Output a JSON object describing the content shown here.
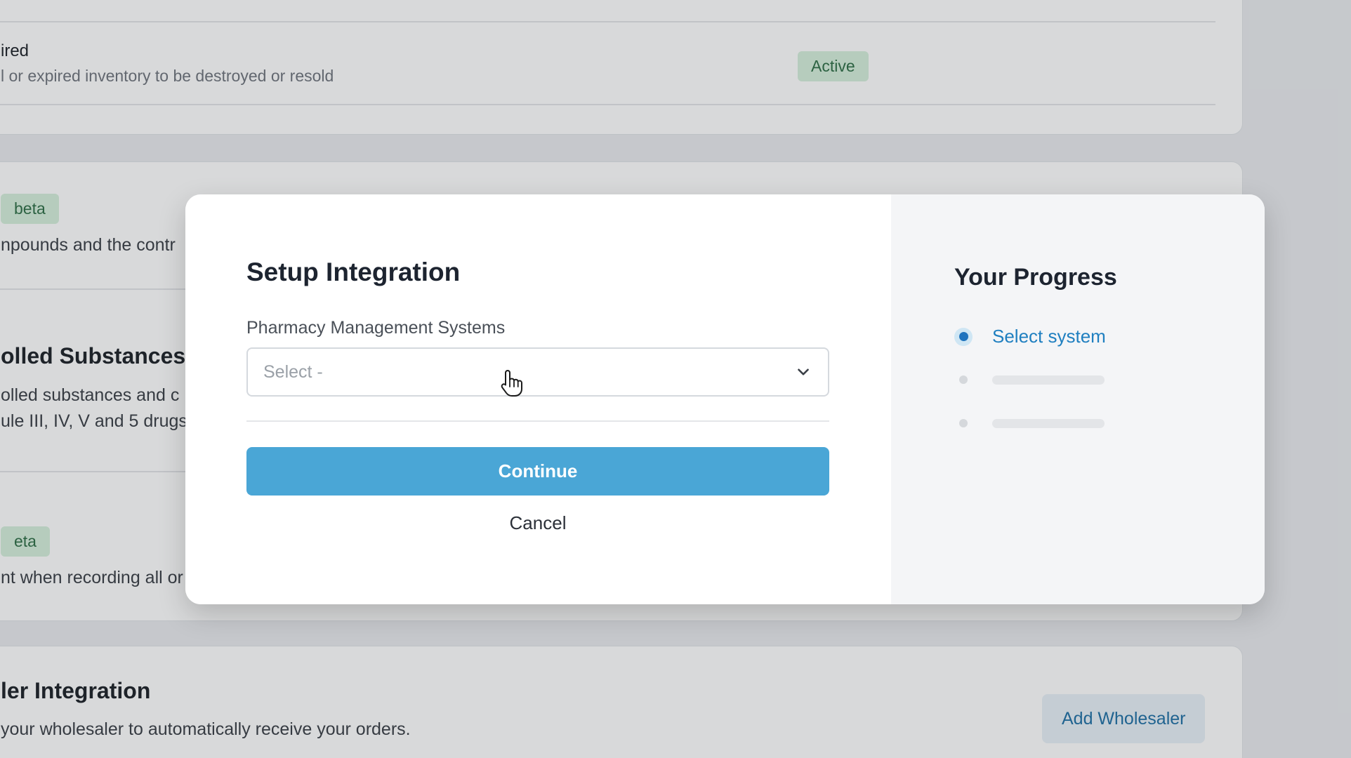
{
  "background": {
    "row1": {
      "title": "ired",
      "subtitle": "l or expired inventory to be destroyed or resold",
      "badge": "Active"
    },
    "row2": {
      "badge": "beta",
      "subtitle": "npounds and the contr"
    },
    "row3": {
      "title": "olled Substances",
      "subtitle_line1": "olled substances and c",
      "subtitle_line2": "ule III, IV, V and 5 drugs"
    },
    "row4": {
      "badge": "eta",
      "subtitle": "nt when recording all or"
    },
    "row5": {
      "title": "ler Integration",
      "subtitle": "your wholesaler to automatically receive your orders.",
      "button": "Add Wholesaler"
    }
  },
  "modal": {
    "title": "Setup Integration",
    "field_label": "Pharmacy Management Systems",
    "select_placeholder": "Select -",
    "continue_label": "Continue",
    "cancel_label": "Cancel",
    "progress": {
      "title": "Your Progress",
      "steps": [
        {
          "label": "Select system",
          "state": "active"
        },
        {
          "label": "",
          "state": "pending"
        },
        {
          "label": "",
          "state": "pending"
        }
      ]
    }
  },
  "colors": {
    "primary": "#4aa6d6",
    "active_step": "#1e73be",
    "badge_bg": "#d6f0dc",
    "badge_text": "#2e6e46"
  },
  "icons": {
    "select_chevron": "chevron-down-icon",
    "cursor": "hand-pointer-icon"
  }
}
